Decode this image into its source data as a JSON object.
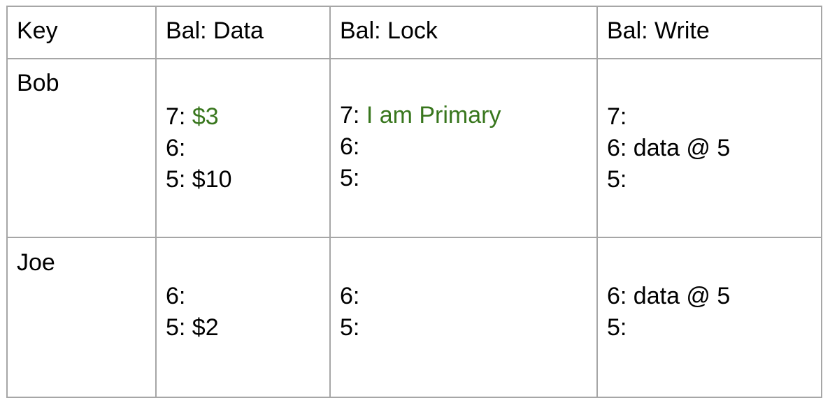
{
  "table": {
    "headers": [
      "Key",
      "Bal: Data",
      "Bal: Lock",
      "Bal: Write"
    ],
    "rows": [
      {
        "key": "Bob",
        "data": [
          {
            "label": "7: ",
            "value": "$3"
          },
          {
            "label": "6:",
            "value": ""
          },
          {
            "label": "5: $10",
            "value": ""
          }
        ],
        "lock": [
          {
            "label": "7: ",
            "value": "I am Primary"
          },
          {
            "label": "6:",
            "value": ""
          },
          {
            "label": "5:",
            "value": ""
          }
        ],
        "write": [
          "7:",
          "6: data @ 5",
          "5:"
        ]
      },
      {
        "key": "Joe",
        "data": [
          "6:",
          "5: $2"
        ],
        "lock": [
          "6:",
          "5:"
        ],
        "write": [
          "6: data @ 5",
          "5:"
        ]
      }
    ]
  },
  "colors": {
    "grid_line": "#a6a6a6",
    "highlight_text": "#38761d",
    "text": "#000000"
  }
}
